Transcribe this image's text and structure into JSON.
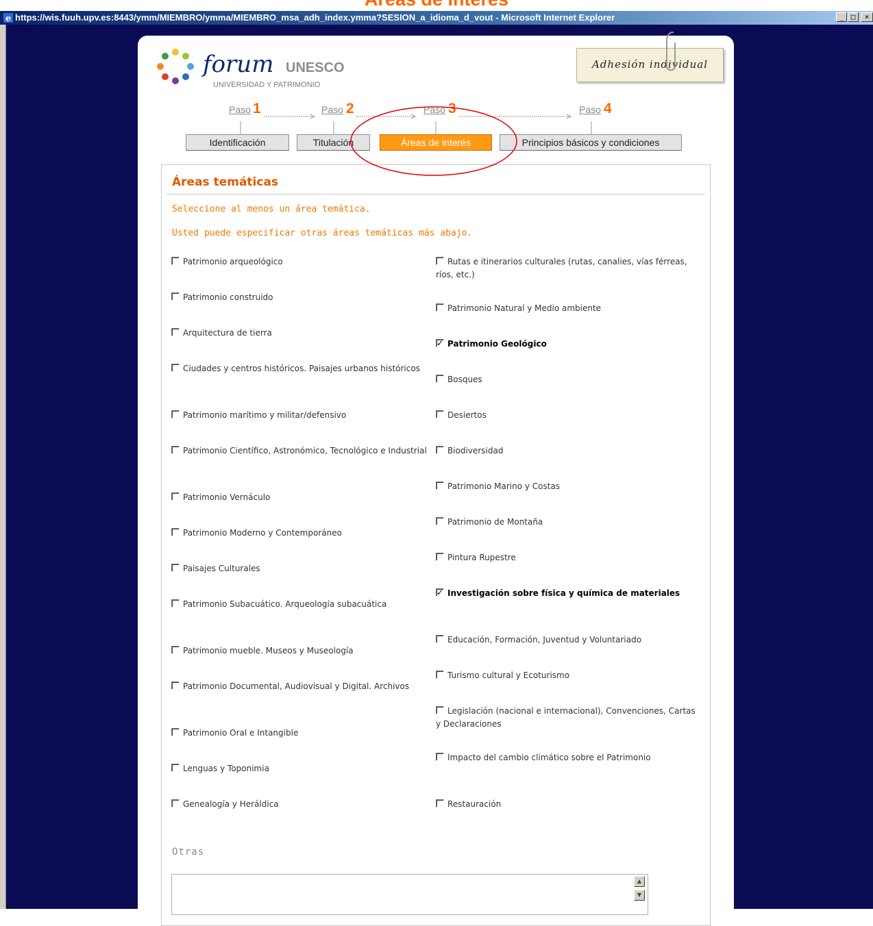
{
  "caption": "Áreas de interés",
  "window": {
    "title": "https://wis.fuuh.upv.es:8443/ymm/MIEMBRO/ymma/MIEMBRO_msa_adh_index.ymma?SESION_a_idioma_d_vout - Microsoft Internet Explorer",
    "minimize": "_",
    "maximize": "□",
    "close": "×"
  },
  "logo": {
    "forum": "forum",
    "unesco": "UNESCO",
    "subtitle": "UNIVERSIDAD Y PATRIMONIO"
  },
  "badge": "Adhesión individual",
  "steps": [
    {
      "label": "Paso",
      "num": "1",
      "tab": "Identificación"
    },
    {
      "label": "Paso",
      "num": "2",
      "tab": "Titulación"
    },
    {
      "label": "Paso",
      "num": "3",
      "tab": "Áreas de interés"
    },
    {
      "label": "Paso",
      "num": "4",
      "tab": "Principios básicos y condiciones"
    }
  ],
  "active_step": 3,
  "section": {
    "title": "Áreas temáticas",
    "note1": "Seleccione al menos un área temática.",
    "note2": "Usted puede especificar otras áreas temáticas más abajo."
  },
  "areas_left": [
    {
      "label": "Patrimonio arqueológico",
      "checked": false
    },
    {
      "label": "Patrimonio construido",
      "checked": false
    },
    {
      "label": "Arquitectura de tierra",
      "checked": false
    },
    {
      "label": "Ciudades y centros históricos. Paisajes urbanos históricos",
      "checked": false
    },
    {
      "label": "Patrimonio marítimo y militar/defensivo",
      "checked": false
    },
    {
      "label": "Patrimonio Científico, Astronómico, Tecnológico e Industrial",
      "checked": false
    },
    {
      "label": "Patrimonio Vernáculo",
      "checked": false
    },
    {
      "label": "Patrimonio Moderno y Contemporáneo",
      "checked": false
    },
    {
      "label": "Paisajes Culturales",
      "checked": false
    },
    {
      "label": "Patrimonio Subacuático. Arqueología subacuática",
      "checked": false
    },
    {
      "label": "Patrimonio mueble. Museos y Museología",
      "checked": false
    },
    {
      "label": "Patrimonio Documental, Audiovisual y Digital. Archivos",
      "checked": false
    },
    {
      "label": "Patrimonio Oral e Intangible",
      "checked": false
    },
    {
      "label": "Lenguas y Toponimia",
      "checked": false
    },
    {
      "label": "Genealogía y Heráldica",
      "checked": false
    }
  ],
  "areas_right": [
    {
      "label": "Rutas e itinerarios culturales (rutas, canalies, vías férreas, ríos, etc.)",
      "checked": false
    },
    {
      "label": "Patrimonio Natural y Medio ambiente",
      "checked": false
    },
    {
      "label": "Patrimonio Geológico",
      "checked": true
    },
    {
      "label": "Bosques",
      "checked": false
    },
    {
      "label": "Desiertos",
      "checked": false
    },
    {
      "label": "Biodiversidad",
      "checked": false
    },
    {
      "label": "Patrimonio Marino y Costas",
      "checked": false
    },
    {
      "label": "Patrimonio de Montaña",
      "checked": false
    },
    {
      "label": "Pintura Rupestre",
      "checked": false
    },
    {
      "label": "Investigación sobre física y química de materiales",
      "checked": true
    },
    {
      "label": "Educación, Formación, Juventud y Voluntariado",
      "checked": false
    },
    {
      "label": "Turismo cultural y Ecoturismo",
      "checked": false
    },
    {
      "label": "Legislación (nacional e internacional), Convenciones, Cartas y Declaraciones",
      "checked": false
    },
    {
      "label": "Impacto del cambio climático sobre el Patrimonio",
      "checked": false
    },
    {
      "label": "Restauración",
      "checked": false
    }
  ],
  "otras": {
    "label": "Otras",
    "value": ""
  },
  "colors": {
    "accent": "#ff6600",
    "active_tab": "#ff9a17",
    "annotation": "#e00000",
    "background": "#0b0b55"
  },
  "icons": [
    "ie-icon",
    "paperclip-icon",
    "scroll-up-icon",
    "scroll-down-icon"
  ]
}
